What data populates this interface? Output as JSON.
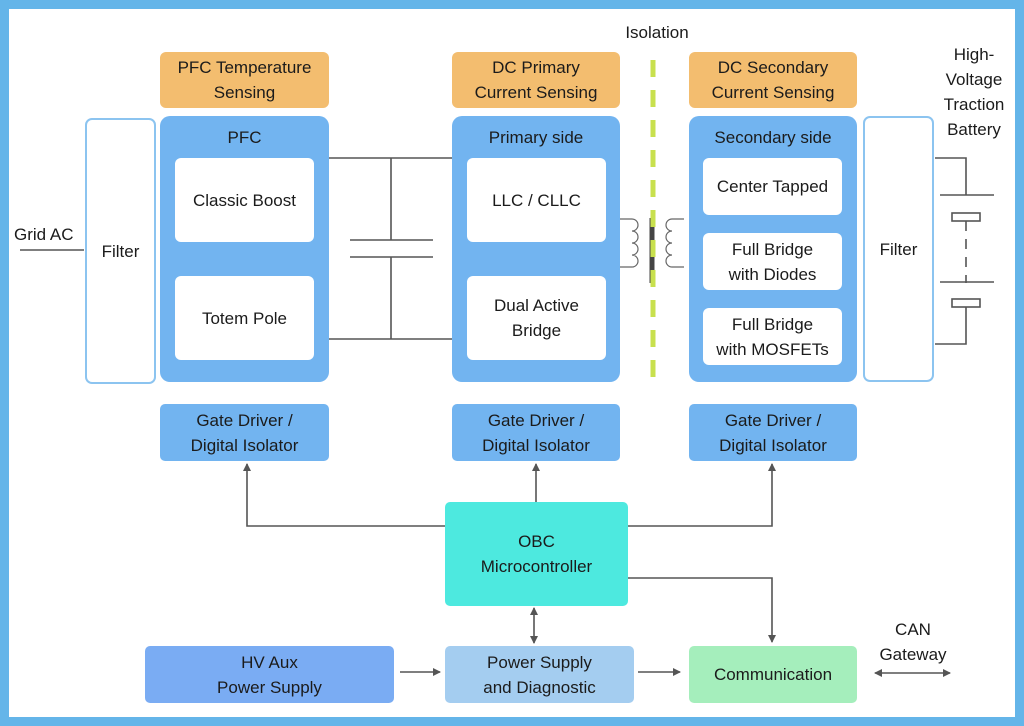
{
  "labels": {
    "grid_ac": "Grid AC",
    "isolation": "Isolation",
    "battery": "High-\nVoltage\nTraction\nBattery",
    "can_gateway": "CAN\nGateway"
  },
  "sensing": {
    "pfc_temp": "PFC Temperature\nSensing",
    "dc_primary": "DC Primary\nCurrent Sensing",
    "dc_secondary": "DC Secondary\nCurrent Sensing"
  },
  "filters": {
    "input": "Filter",
    "output": "Filter"
  },
  "pfc": {
    "title": "PFC",
    "items": [
      "Classic Boost",
      "Totem Pole"
    ]
  },
  "primary": {
    "title": "Primary side",
    "items": [
      "LLC / CLLC",
      "Dual Active\nBridge"
    ]
  },
  "secondary": {
    "title": "Secondary side",
    "items": [
      "Center Tapped",
      "Full Bridge\nwith Diodes",
      "Full Bridge\nwith MOSFETs"
    ]
  },
  "gate_drivers": [
    "Gate Driver /\nDigital Isolator",
    "Gate Driver /\nDigital Isolator",
    "Gate Driver /\nDigital Isolator"
  ],
  "control": {
    "mcu": "OBC\nMicrocontroller",
    "hv_aux": "HV Aux\nPower Supply",
    "power_diag": "Power Supply\nand Diagnostic",
    "communication": "Communication"
  },
  "colors": {
    "frame": "#64b5e9",
    "sensing": "#f3bd6f",
    "stage": "#72b4f0",
    "mcu": "#4de9df",
    "hv_aux": "#7aacf3",
    "power_diag": "#a4cdf0",
    "communication": "#a5eebc",
    "isolation_line": "#c8e04e"
  }
}
